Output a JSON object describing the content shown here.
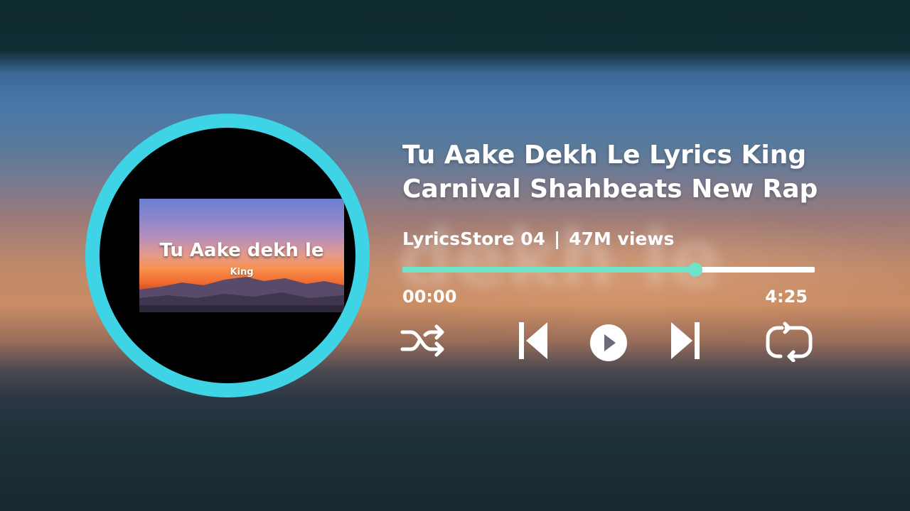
{
  "album_art": {
    "thumbnail_title": "Tu Aake dekh le",
    "thumbnail_artist": "King"
  },
  "track": {
    "title_line1": "Tu Aake Dekh Le Lyrics King",
    "title_line2": "Carnival Shahbeats New Rap",
    "channel": "LyricsStore 04",
    "separator": "|",
    "views": "47M views"
  },
  "playback": {
    "current_time": "00:00",
    "total_time": "4:25",
    "progress_fraction": 0.71
  },
  "controls": {
    "shuffle": "shuffle-icon",
    "previous": "skip-previous-icon",
    "play": "play-icon",
    "next": "skip-next-icon",
    "repeat": "repeat-icon"
  },
  "colors": {
    "ring": "#3fd3e6",
    "progress_fill": "#6ee3c8",
    "progress_track": "#ffffff"
  }
}
